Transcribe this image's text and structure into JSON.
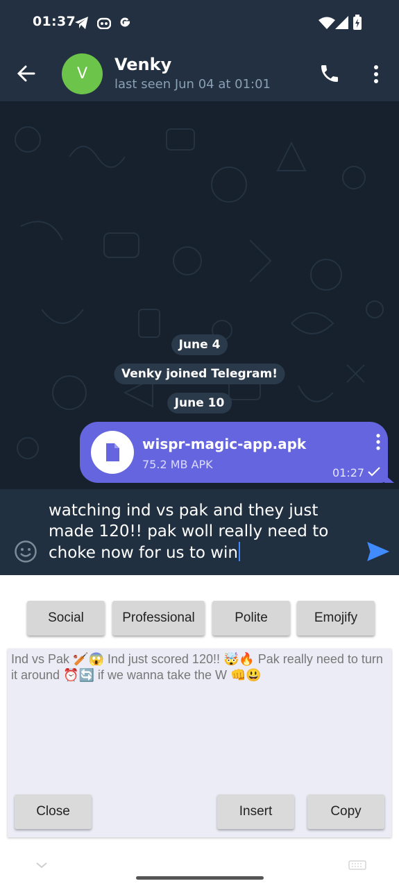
{
  "status_bar": {
    "time": "01:37"
  },
  "header": {
    "avatar_letter": "V",
    "contact_name": "Venky",
    "last_seen": "last seen Jun 04 at 01:01"
  },
  "chat": {
    "date_1": "June 4",
    "service_message": "Venky joined Telegram!",
    "date_2": "June 10",
    "file_message": {
      "file_name": "wispr-magic-app.apk",
      "file_info": "75.2 MB APK",
      "time": "01:27"
    }
  },
  "composer": {
    "text": "watching ind vs pak and they just made 120!! pak woll really need to choke now for us to win"
  },
  "panel": {
    "tone_buttons": [
      "Social",
      "Professional",
      "Polite",
      "Emojify"
    ],
    "rewritten_text": "Ind vs Pak 🏏😱 Ind just scored 120!! 🤯🔥 Pak really need to turn it around ⏰🔄 if we wanna take the W 👊😃",
    "close_label": "Close",
    "insert_label": "Insert",
    "copy_label": "Copy"
  },
  "colors": {
    "header_bg": "#233041",
    "chat_bg": "#17212d",
    "bubble": "#6565e0",
    "avatar": "#6cc44a",
    "send_icon": "#3f8bff"
  }
}
